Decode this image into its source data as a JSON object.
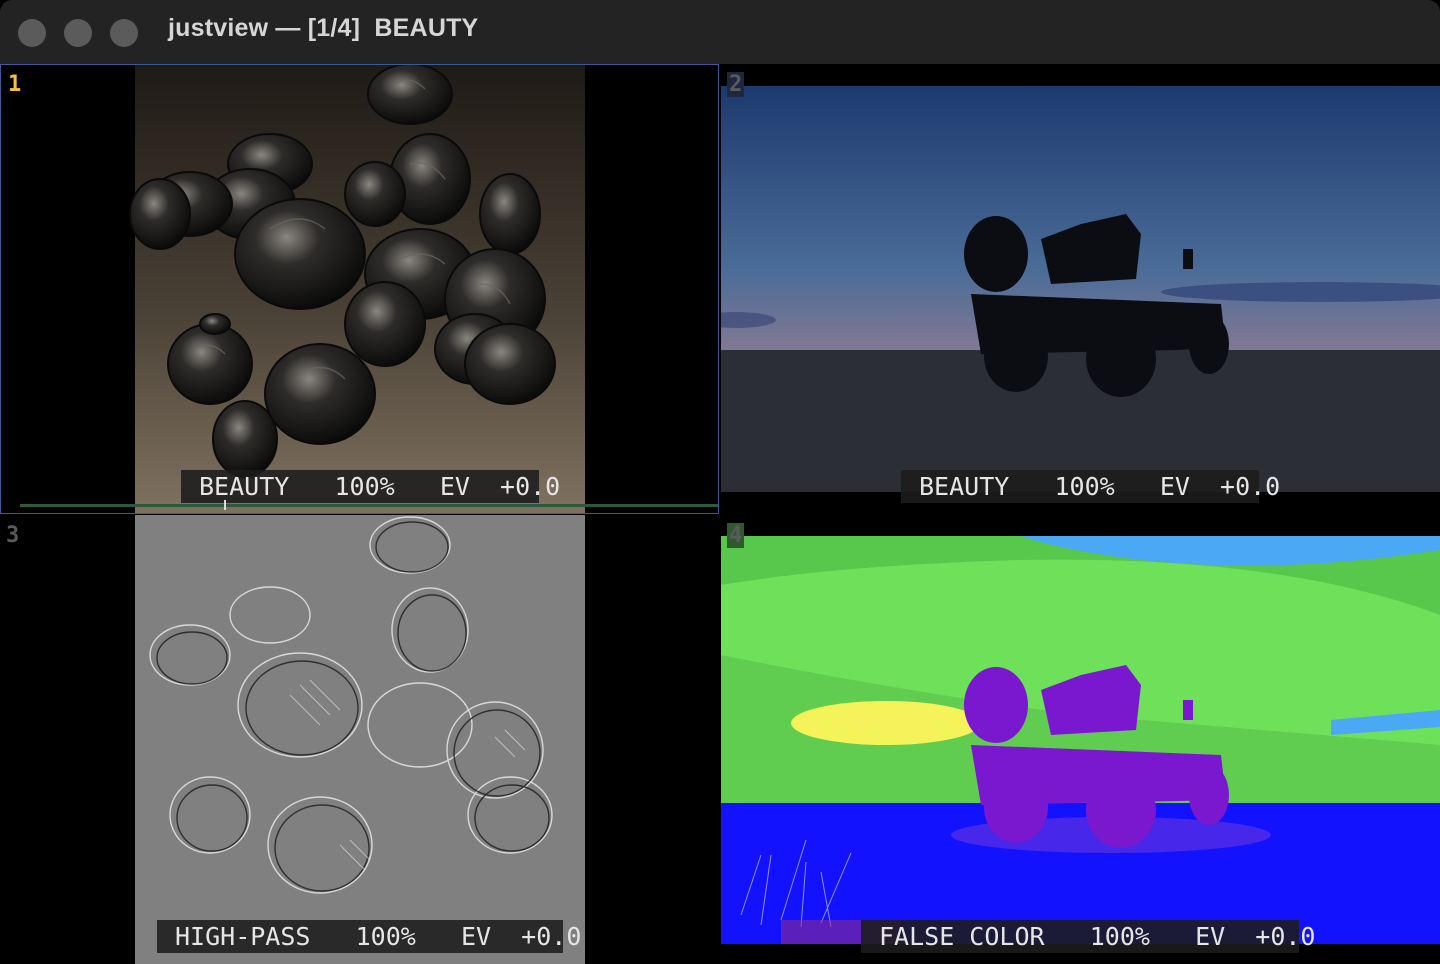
{
  "window": {
    "title": "justview — [1/4]  BEAUTY",
    "controls": [
      "close-button",
      "minimize-button",
      "zoom-button"
    ]
  },
  "panes": [
    {
      "number": "1",
      "image": "rocks render",
      "hud": {
        "mode": "BEAUTY",
        "zoom": "100%",
        "ev_label": "EV",
        "ev": "+0.0"
      },
      "active": true
    },
    {
      "number": "2",
      "image": "jeep at sunset",
      "hud": {
        "mode": "BEAUTY",
        "zoom": "100%",
        "ev_label": "EV",
        "ev": "+0.0"
      },
      "active": false
    },
    {
      "number": "3",
      "image": "rocks high-pass",
      "hud": {
        "mode": "HIGH-PASS",
        "zoom": "100%",
        "ev_label": "EV",
        "ev": "+0.0"
      },
      "active": false
    },
    {
      "number": "4",
      "image": "jeep false color",
      "hud": {
        "mode": "FALSE COLOR",
        "zoom": "100%",
        "ev_label": "EV",
        "ev": "+0.0"
      },
      "active": false
    }
  ],
  "hud_lines": [
    "BEAUTY   100%   EV  +0.0",
    "BEAUTY   100%   EV  +0.0",
    "HIGH-PASS   100%   EV  +0.0",
    "FALSE COLOR   100%   EV  +0.0"
  ],
  "colors": {
    "titlebar": "#232323",
    "active_border": "#3a5a9a",
    "active_number": "#f0c040",
    "inactive_number": "#5a5a5a",
    "false_color_green": "#6fe05a",
    "false_color_blue": "#1212ff",
    "false_color_purple": "#7a18d0",
    "false_color_yellow": "#f4f45a",
    "false_color_sky": "#4aa8f4"
  }
}
